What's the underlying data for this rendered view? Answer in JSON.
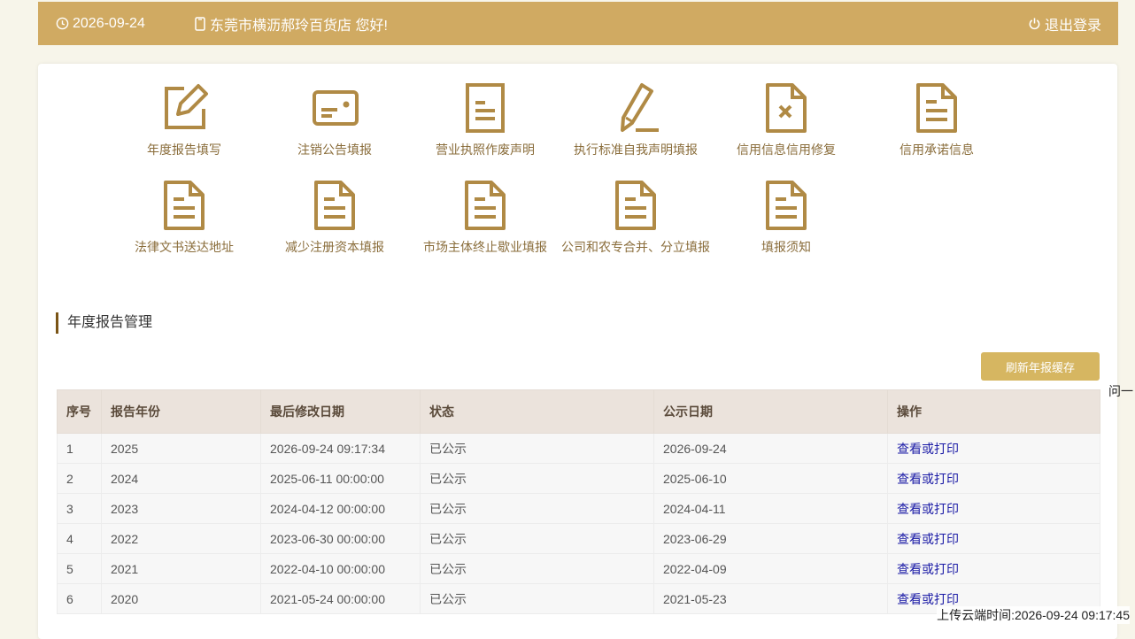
{
  "header": {
    "date": "2026-09-24",
    "greeting": "东莞市横沥郝玲百货店 您好!",
    "logout": "退出登录"
  },
  "functions": [
    {
      "label": "年度报告填写",
      "icon": "edit-icon"
    },
    {
      "label": "注销公告填报",
      "icon": "card-icon"
    },
    {
      "label": "营业执照作废声明",
      "icon": "document-icon"
    },
    {
      "label": "执行标准自我声明填报",
      "icon": "pencil-icon"
    },
    {
      "label": "信用信息信用修复",
      "icon": "document-x-icon"
    },
    {
      "label": "信用承诺信息",
      "icon": "document-icon"
    },
    {
      "label": "法律文书送达地址",
      "icon": "document-icon"
    },
    {
      "label": "减少注册资本填报",
      "icon": "document-icon"
    },
    {
      "label": "市场主体终止歇业填报",
      "icon": "document-icon"
    },
    {
      "label": "公司和农专合并、分立填报",
      "icon": "document-icon"
    },
    {
      "label": "填报须知",
      "icon": "document-icon"
    }
  ],
  "section_title": "年度报告管理",
  "refresh_button": "刷新年报缓存",
  "table": {
    "headers": [
      "序号",
      "报告年份",
      "最后修改日期",
      "状态",
      "公示日期",
      "操作"
    ],
    "rows": [
      [
        "1",
        "2025",
        "2026-09-24 09:17:34",
        "已公示",
        "2026-09-24",
        "查看或打印"
      ],
      [
        "2",
        "2024",
        "2025-06-11 00:00:00",
        "已公示",
        "2025-06-10",
        "查看或打印"
      ],
      [
        "3",
        "2023",
        "2024-04-12 00:00:00",
        "已公示",
        "2024-04-11",
        "查看或打印"
      ],
      [
        "4",
        "2022",
        "2023-06-30 00:00:00",
        "已公示",
        "2023-06-29",
        "查看或打印"
      ],
      [
        "5",
        "2021",
        "2022-04-10 00:00:00",
        "已公示",
        "2022-04-09",
        "查看或打印"
      ],
      [
        "6",
        "2020",
        "2021-05-24 00:00:00",
        "已公示",
        "2021-05-23",
        "查看或打印"
      ]
    ]
  },
  "side_text": "问一",
  "upload_time": "上传云端时间:2026-09-24 09:17:45",
  "colors": {
    "header_bg": "#d0aa62",
    "icon": "#b08a45",
    "button": "#d6b661",
    "link": "#1a1aa6"
  }
}
